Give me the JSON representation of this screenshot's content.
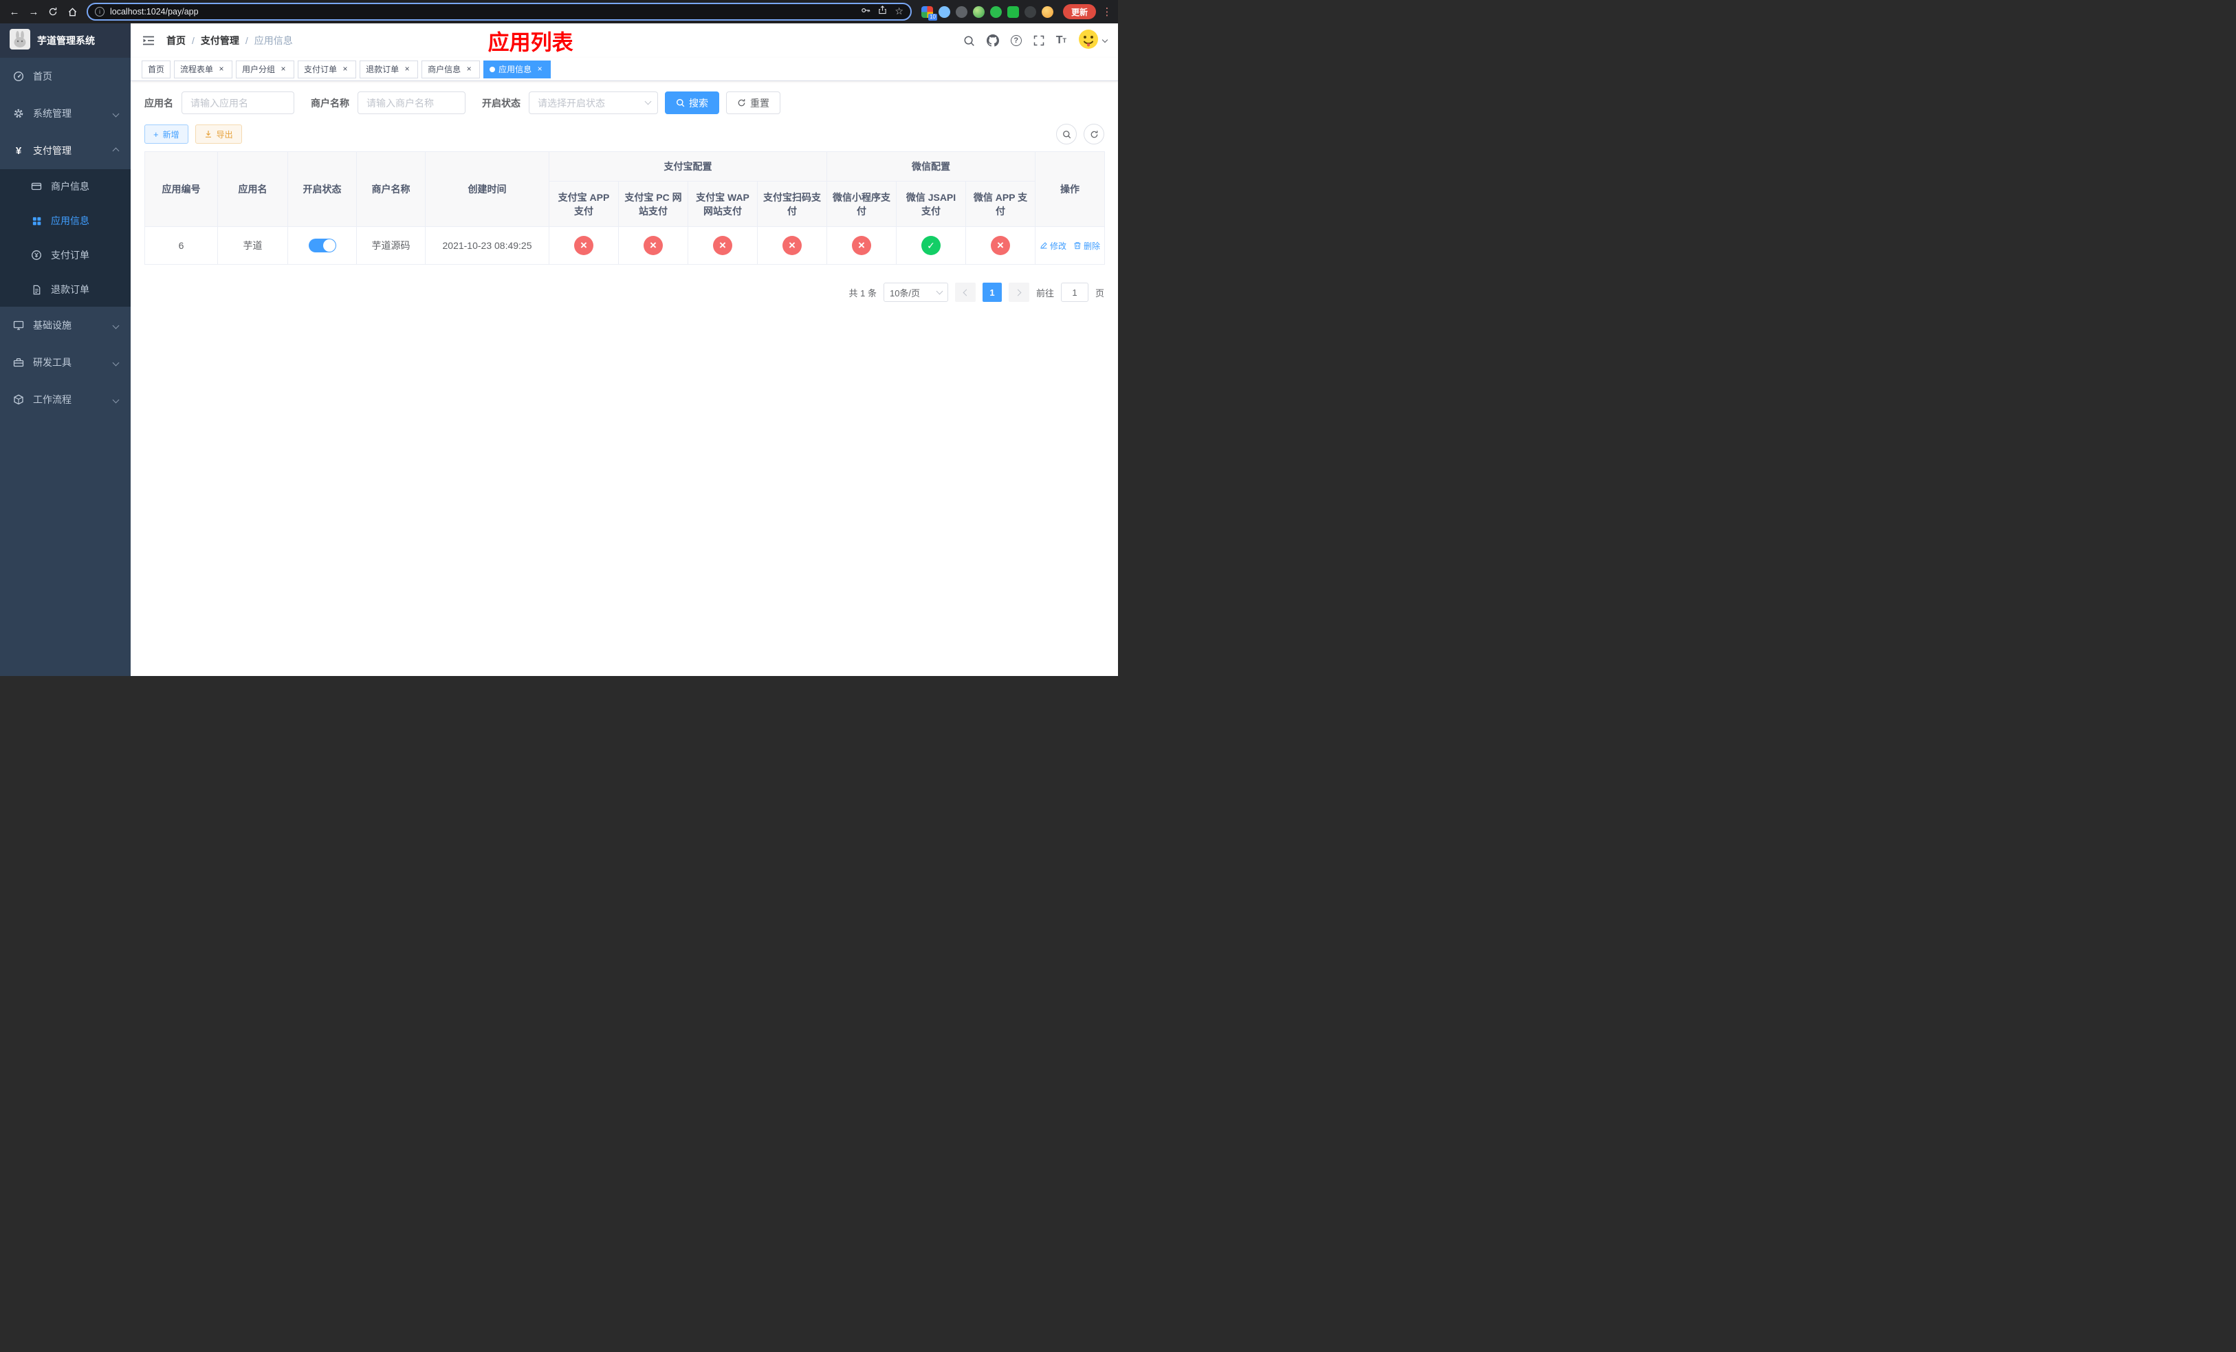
{
  "colors": {
    "accent": "#409eff",
    "success": "#13ce66",
    "danger": "#f56c6c",
    "warning": "#e6a23c",
    "sidebar_bg": "#304156",
    "sidebar_sub_bg": "#1f2d3d",
    "annotation_red": "#ff0000"
  },
  "browser": {
    "url": "localhost:1024/pay/app",
    "update_label": "更新",
    "extension_badge": "10"
  },
  "sidebar": {
    "title": "芋道管理系统",
    "items": [
      {
        "label": "首页"
      },
      {
        "label": "系统管理"
      },
      {
        "label": "支付管理",
        "expanded": true,
        "children": [
          {
            "label": "商户信息"
          },
          {
            "label": "应用信息",
            "active": true
          },
          {
            "label": "支付订单"
          },
          {
            "label": "退款订单"
          }
        ]
      },
      {
        "label": "基础设施"
      },
      {
        "label": "研发工具"
      },
      {
        "label": "工作流程"
      }
    ]
  },
  "header": {
    "breadcrumb": [
      "首页",
      "支付管理",
      "应用信息"
    ],
    "annotation": "应用列表"
  },
  "tabs": [
    {
      "label": "首页",
      "closable": false
    },
    {
      "label": "流程表单",
      "closable": true
    },
    {
      "label": "用户分组",
      "closable": true
    },
    {
      "label": "支付订单",
      "closable": true
    },
    {
      "label": "退款订单",
      "closable": true
    },
    {
      "label": "商户信息",
      "closable": true
    },
    {
      "label": "应用信息",
      "closable": true,
      "active": true
    }
  ],
  "filters": {
    "app_name_label": "应用名",
    "app_name_placeholder": "请输入应用名",
    "merchant_label": "商户名称",
    "merchant_placeholder": "请输入商户名称",
    "status_label": "开启状态",
    "status_placeholder": "请选择开启状态",
    "search_label": "搜索",
    "reset_label": "重置"
  },
  "toolbar": {
    "add_label": "新增",
    "export_label": "导出"
  },
  "table": {
    "groups": {
      "alipay": "支付宝配置",
      "wechat": "微信配置"
    },
    "columns": {
      "id": "应用编号",
      "name": "应用名",
      "status": "开启状态",
      "merchant": "商户名称",
      "created": "创建时间",
      "alipay_app": "支付宝 APP 支付",
      "alipay_pc": "支付宝 PC 网站支付",
      "alipay_wap": "支付宝 WAP 网站支付",
      "alipay_qr": "支付宝扫码支付",
      "wx_lite": "微信小程序支付",
      "wx_jsapi": "微信 JSAPI 支付",
      "wx_app": "微信 APP 支付",
      "actions": "操作"
    },
    "edit_label": "修改",
    "delete_label": "删除",
    "rows": [
      {
        "id": "6",
        "name": "芋道",
        "status_enabled": true,
        "merchant": "芋道源码",
        "created": "2021-10-23 08:49:25",
        "alipay_app": false,
        "alipay_pc": false,
        "alipay_wap": false,
        "alipay_qr": false,
        "wx_lite": false,
        "wx_jsapi": true,
        "wx_app": false
      }
    ]
  },
  "pagination": {
    "total_text": "共 1 条",
    "page_size": "10条/页",
    "current_page": "1",
    "goto_label": "前往",
    "goto_value": "1",
    "goto_unit": "页"
  }
}
